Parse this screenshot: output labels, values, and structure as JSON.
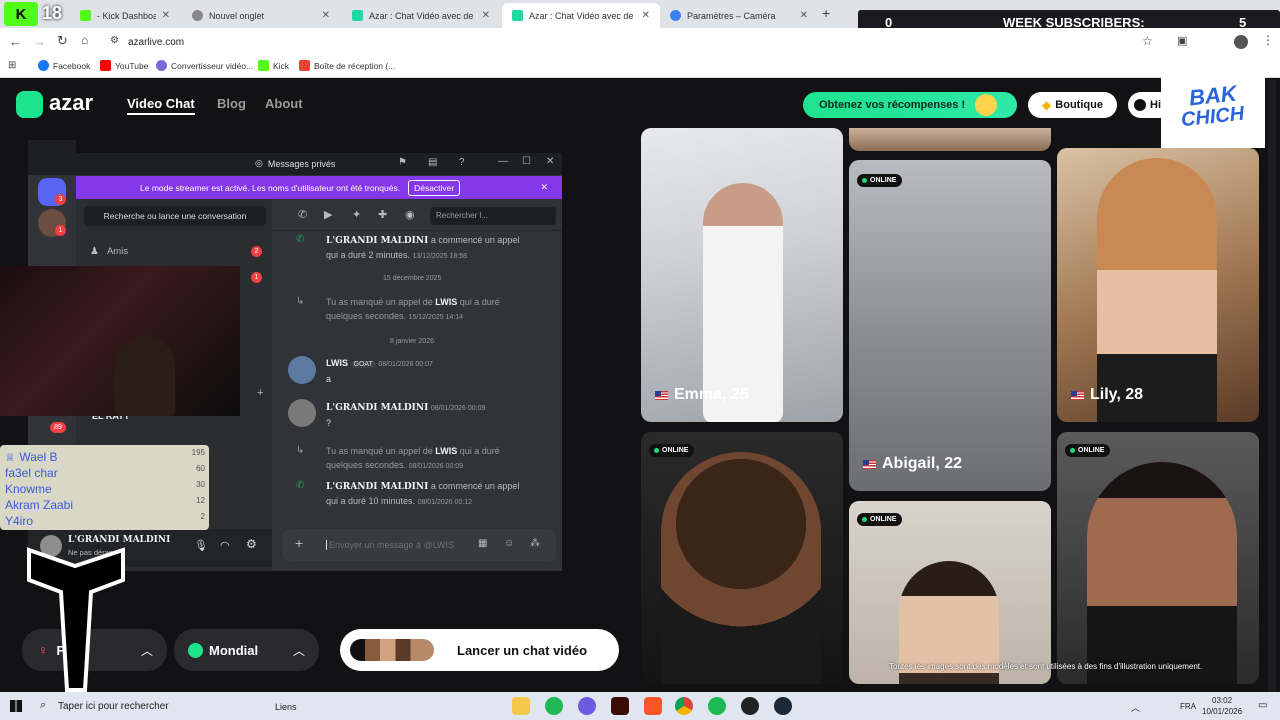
{
  "stream": {
    "kick_number": "18",
    "week_subscribers_label": "WEEK SUBSCRIBERS:",
    "week_subscribers_left": "0",
    "week_subscribers_right": "5",
    "bakchich_line1": "BAK",
    "bakchich_line2": "CHICH",
    "leaderboard": [
      {
        "name": "Wael B",
        "value": "195"
      },
      {
        "name": "fa3el char",
        "value": "60"
      },
      {
        "name": "Knowme",
        "value": "30"
      },
      {
        "name": "Akram Zaabi",
        "value": "12"
      },
      {
        "name": "Y4iro",
        "value": "2"
      }
    ]
  },
  "browser": {
    "tabs": [
      {
        "label": "- Kick Dashboard",
        "color": "#53fc18"
      },
      {
        "label": "Nouvel onglet",
        "color": "#777"
      },
      {
        "label": "Azar : Chat Vidéo avec de nouv",
        "color": "#1fd8a4"
      },
      {
        "label": "Azar : Chat Vidéo avec de nouv",
        "color": "#1fd8a4"
      },
      {
        "label": "Paramètres – Caméra",
        "color": "#3b82f6"
      }
    ],
    "url": "azarlive.com",
    "bookmarks": [
      "Facebook",
      "YouTube",
      "Convertisseur vidéo...",
      "Kick",
      "Boîte de réception (..."
    ]
  },
  "azar": {
    "logo": "azar",
    "nav": [
      "Video Chat",
      "Blog",
      "About"
    ],
    "rewards_label": "Obtenez vos récompenses !",
    "shop_label": "Boutique",
    "hi_label": "Hi",
    "online_label": "ONLINE",
    "cards": [
      {
        "name": "Emma, 25"
      },
      {
        "name": "Lily, 28"
      },
      {
        "name": "Abigail, 22"
      }
    ],
    "gender_label": "F",
    "region_label": "Mondial",
    "start_label": "Lancer un chat vidéo",
    "disclaimer": "Toutes les images sont des modèles et sont utilisées à des fins d'illustration uniquement."
  },
  "discord": {
    "title": "Messages privés",
    "banner": "Le mode streamer est activé. Les noms d'utilisateur ont été tronqués.",
    "banner_button": "Désactiver",
    "search_conv": "Recherche ou lance une conversation",
    "friends": "Amis",
    "friends_badge": "2",
    "dm_badge": "1",
    "search_placeholder": "Rechercher l...",
    "messages": {
      "m1_name": "L'GRANDI MALDINI",
      "m1_text": "a commencé un appel",
      "m1_text2": "qui a duré 2 minutes.",
      "m1_time": "13/12/2025 18:58",
      "date1": "15 décembre 2025",
      "m2_text": "Tu as manqué un appel de",
      "m2_name": "LWIS",
      "m2_text2": "qui a duré",
      "m2_text3": "quelques secondes.",
      "m2_time": "15/12/2025 14:14",
      "date2": "8 janvier 2026",
      "m3_name": "LWIS",
      "m3_badge": "GOAT",
      "m3_time": "08/01/2026 00:07",
      "m3_body": "a",
      "m4_name": "L'GRANDI MALDINI",
      "m4_time": "08/01/2026 00:09",
      "m4_body": "?",
      "m5_text": "Tu as manqué un appel de",
      "m5_name": "LWIS",
      "m5_text2": "qui a duré",
      "m5_text3": "quelques secondes.",
      "m5_time": "08/01/2026 00:09",
      "m6_name": "L'GRANDI MALDINI",
      "m6_text": "a commencé un appel",
      "m6_text2": "qui a duré 10 minutes.",
      "m6_time": "08/01/2026 00:12"
    },
    "input_placeholder": "Envoyer un message à @LWIS",
    "user_name": "L'GRANDI MALDINI",
    "user_status": "Ne pas déranger",
    "server_badges": [
      "3",
      "1"
    ],
    "side_badge": "89",
    "sidebar_name": "EL RAYT"
  },
  "taskbar": {
    "search": "Taper ici pour rechercher",
    "links": "Liens",
    "lang": "FRA",
    "time": "03:02",
    "date": "10/01/2026"
  }
}
